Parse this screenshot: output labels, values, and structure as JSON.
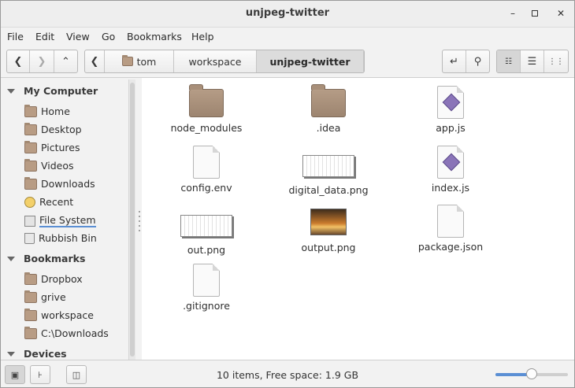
{
  "window": {
    "title": "unjpeg-twitter"
  },
  "menu": [
    "File",
    "Edit",
    "View",
    "Go",
    "Bookmarks",
    "Help"
  ],
  "breadcrumbs": [
    {
      "label": "tom",
      "icon": "home-folder-icon"
    },
    {
      "label": "workspace"
    },
    {
      "label": "unjpeg-twitter",
      "active": true
    }
  ],
  "sidebar": {
    "sections": [
      {
        "title": "My Computer",
        "items": [
          {
            "label": "Home",
            "icon": "home-folder-icon"
          },
          {
            "label": "Desktop",
            "icon": "desktop-folder-icon"
          },
          {
            "label": "Pictures",
            "icon": "pictures-folder-icon"
          },
          {
            "label": "Videos",
            "icon": "videos-folder-icon"
          },
          {
            "label": "Downloads",
            "icon": "downloads-folder-icon"
          },
          {
            "label": "Recent",
            "icon": "clock-icon"
          },
          {
            "label": "File System",
            "icon": "drive-icon"
          },
          {
            "label": "Rubbish Bin",
            "icon": "trash-icon"
          }
        ]
      },
      {
        "title": "Bookmarks",
        "items": [
          {
            "label": "Dropbox",
            "icon": "folder-icon"
          },
          {
            "label": "grive",
            "icon": "folder-icon"
          },
          {
            "label": "workspace",
            "icon": "folder-icon"
          },
          {
            "label": "C:\\Downloads",
            "icon": "folder-icon"
          }
        ]
      },
      {
        "title": "Devices",
        "items": []
      }
    ]
  },
  "files": [
    {
      "name": "node_modules",
      "type": "folder"
    },
    {
      "name": ".idea",
      "type": "folder"
    },
    {
      "name": "app.js",
      "type": "js"
    },
    {
      "name": "config.env",
      "type": "doc"
    },
    {
      "name": "digital_data.png",
      "type": "image-wide"
    },
    {
      "name": "index.js",
      "type": "js"
    },
    {
      "name": "out.png",
      "type": "image-wide"
    },
    {
      "name": "output.png",
      "type": "image-photo"
    },
    {
      "name": "package.json",
      "type": "doc"
    },
    {
      "name": ".gitignore",
      "type": "doc"
    }
  ],
  "status": {
    "text": "10 items, Free space: 1.9 GB",
    "zoom": 0.5
  },
  "colors": {
    "accent": "#5b8fd4",
    "folder": "#b89c84"
  }
}
